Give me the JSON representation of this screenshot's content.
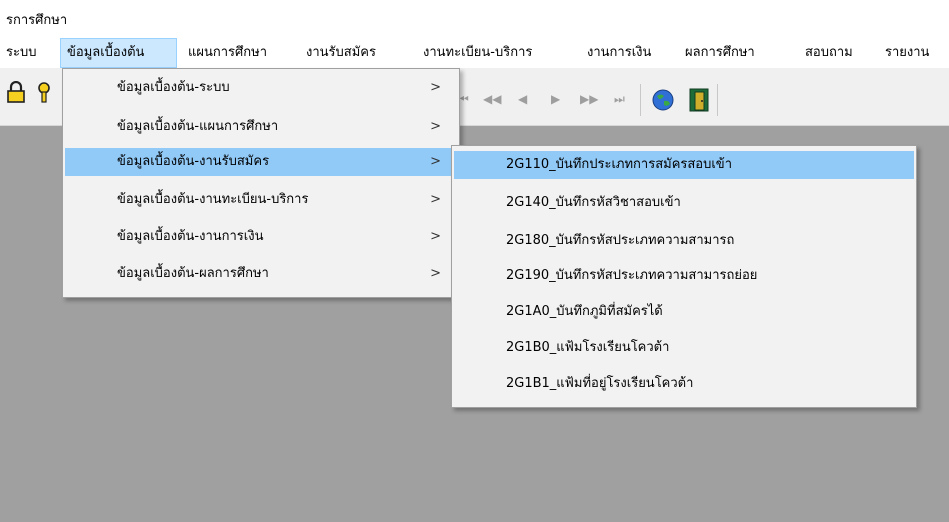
{
  "window": {
    "title": "รการศึกษา"
  },
  "menubar": {
    "items": [
      {
        "label": "ระบบ"
      },
      {
        "label": "ข้อมูลเบื้องต้น"
      },
      {
        "label": "แผนการศึกษา"
      },
      {
        "label": "งานรับสมัคร"
      },
      {
        "label": "งานทะเบียน-บริการ"
      },
      {
        "label": "งานการเงิน"
      },
      {
        "label": "ผลการศึกษา"
      },
      {
        "label": "สอบถาม"
      },
      {
        "label": "รายงาน"
      }
    ]
  },
  "toolbar": {
    "nav": {
      "first": "⏮",
      "prev_page": "◀◀",
      "prev": "◀",
      "next": "▶",
      "next_page": "▶▶",
      "last": "⏭"
    }
  },
  "dropdown": {
    "items": [
      {
        "label": "ข้อมูลเบื้องต้น-ระบบ",
        "arrow": ">"
      },
      {
        "label": "ข้อมูลเบื้องต้น-แผนการศึกษา",
        "arrow": ">"
      },
      {
        "label": "ข้อมูลเบื้องต้น-งานรับสมัคร",
        "arrow": ">"
      },
      {
        "label": "ข้อมูลเบื้องต้น-งานทะเบียน-บริการ",
        "arrow": ">"
      },
      {
        "label": "ข้อมูลเบื้องต้น-งานการเงิน",
        "arrow": ">"
      },
      {
        "label": "ข้อมูลเบื้องต้น-ผลการศึกษา",
        "arrow": ">"
      }
    ]
  },
  "submenu": {
    "items": [
      {
        "label": "2G110_บันทึกประเภทการสมัครสอบเข้า"
      },
      {
        "label": "2G140_บันทึกรหัสวิชาสอบเข้า"
      },
      {
        "label": "2G180_บันทึกรหัสประเภทความสามารถ"
      },
      {
        "label": "2G190_บันทึกรหัสประเภทความสามารถย่อย"
      },
      {
        "label": "2G1A0_บันทึกภูมิที่สมัครได้"
      },
      {
        "label": "2G1B0_แฟ้มโรงเรียนโควต้า"
      },
      {
        "label": "2G1B1_แฟ้มที่อยู่โรงเรียนโควต้า"
      }
    ]
  },
  "colors": {
    "workspace": "#a0a0a0",
    "highlight": "#91c9f7",
    "menubar_active": "#cce8ff"
  }
}
